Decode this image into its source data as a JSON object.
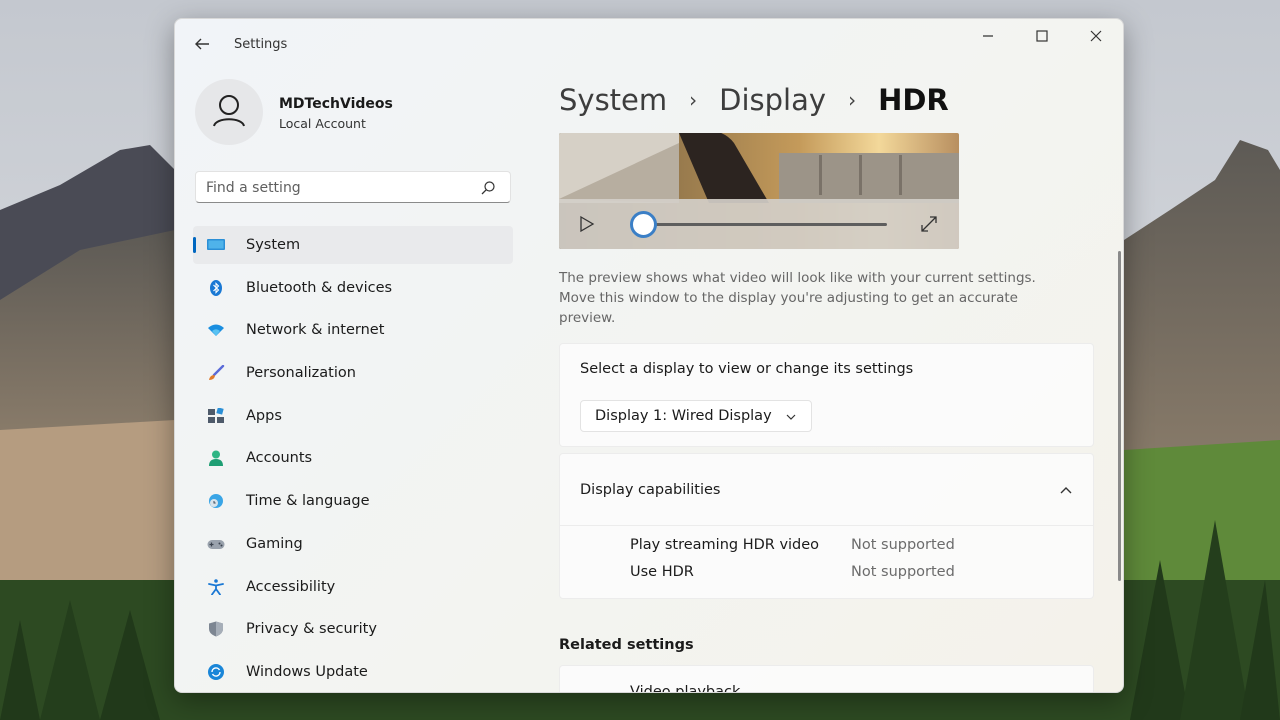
{
  "window": {
    "app_title": "Settings"
  },
  "profile": {
    "name": "MDTechVideos",
    "account_type": "Local Account"
  },
  "search": {
    "placeholder": "Find a setting"
  },
  "sidebar": {
    "items": [
      {
        "label": "System",
        "icon": "monitor-icon",
        "active": true
      },
      {
        "label": "Bluetooth & devices",
        "icon": "bluetooth-icon"
      },
      {
        "label": "Network & internet",
        "icon": "wifi-icon"
      },
      {
        "label": "Personalization",
        "icon": "brush-icon"
      },
      {
        "label": "Apps",
        "icon": "apps-icon"
      },
      {
        "label": "Accounts",
        "icon": "person-icon"
      },
      {
        "label": "Time & language",
        "icon": "globe-clock-icon"
      },
      {
        "label": "Gaming",
        "icon": "gamepad-icon"
      },
      {
        "label": "Accessibility",
        "icon": "accessibility-icon"
      },
      {
        "label": "Privacy & security",
        "icon": "shield-icon"
      },
      {
        "label": "Windows Update",
        "icon": "update-icon"
      }
    ]
  },
  "breadcrumb": {
    "items": [
      "System",
      "Display",
      "HDR"
    ],
    "separator": "›"
  },
  "preview": {
    "note": "The preview shows what video will look like with your current settings. Move this window to the display you're adjusting to get an accurate preview."
  },
  "display_select": {
    "title": "Select a display to view or change its settings",
    "selected": "Display 1: Wired Display"
  },
  "capabilities": {
    "title": "Display capabilities",
    "rows": [
      {
        "label": "Play streaming HDR video",
        "value": "Not supported"
      },
      {
        "label": "Use HDR",
        "value": "Not supported"
      }
    ]
  },
  "related": {
    "title": "Related settings",
    "video_playback": "Video playback"
  },
  "colors": {
    "accent": "#0067c0",
    "window_bg": "#f2f4f4"
  }
}
